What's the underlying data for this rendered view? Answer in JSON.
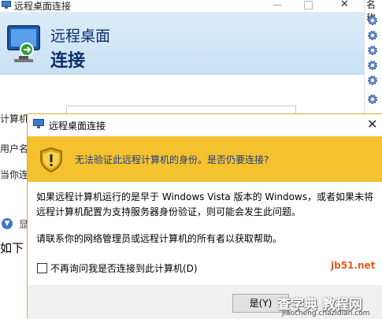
{
  "background_window": {
    "title": "远程桌面连接",
    "banner_line1": "远程桌面",
    "banner_line2": "连接",
    "label_computer": "计算机",
    "label_user": "用户名",
    "label_when": "当你连",
    "show_options": "显",
    "bottom_text": "如下"
  },
  "right_strip": {
    "header": "名称"
  },
  "dialog": {
    "title": "远程桌面连接",
    "warning_text": "无法验证此远程计算机的身份。是否仍要连接?",
    "body_line1": "如果远程计算机运行的是早于 Windows Vista 版本的 Windows，或者如果未将",
    "body_line2": "远程计算机配置为支持服务器身份验证，则可能会发生此问题。",
    "contact_text": "请联系你的网络管理员或远程计算机的所有者以获取帮助。",
    "checkbox_label": "不再询问我是否连接到此计算机(D)",
    "checkbox_checked": false,
    "yes_button": "是(Y)"
  },
  "watermark": {
    "site": "jb51.net",
    "brand": "查字典 教程网",
    "url": "jiaocheng.chazidian.com"
  },
  "icons": {
    "app": "remote-desktop-icon",
    "warning": "warning-shield-icon",
    "service": "gear-icon",
    "close": "close-icon"
  },
  "colors": {
    "warning_bar": "#f4c22e",
    "dialog_border": "#e3a63a",
    "banner_text": "#0a2f6c",
    "warning_text": "#1a3a8a"
  }
}
